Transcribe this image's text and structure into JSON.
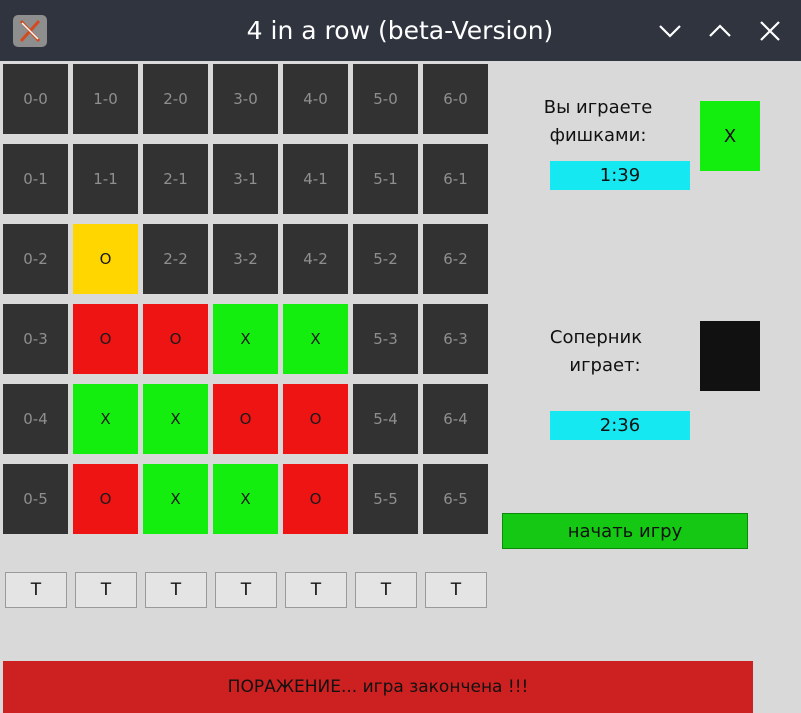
{
  "window": {
    "title": "4 in a row (beta-Version)",
    "app_icon": "x-logo-icon",
    "controls": [
      "minimize-icon",
      "maximize-icon",
      "close-icon"
    ]
  },
  "board": {
    "columns": 7,
    "rows": 6,
    "cells": [
      [
        "0-0",
        "1-0",
        "2-0",
        "3-0",
        "4-0",
        "5-0",
        "6-0"
      ],
      [
        "0-1",
        "1-1",
        "2-1",
        "3-1",
        "4-1",
        "5-1",
        "6-1"
      ],
      [
        "0-2",
        "O",
        "2-2",
        "3-2",
        "4-2",
        "5-2",
        "6-2"
      ],
      [
        "0-3",
        "O",
        "O",
        "X",
        "X",
        "5-3",
        "6-3"
      ],
      [
        "0-4",
        "X",
        "X",
        "O",
        "O",
        "5-4",
        "6-4"
      ],
      [
        "0-5",
        "O",
        "X",
        "X",
        "O",
        "5-5",
        "6-5"
      ]
    ],
    "cell_states": [
      [
        "empty",
        "empty",
        "empty",
        "empty",
        "empty",
        "empty",
        "empty"
      ],
      [
        "empty",
        "empty",
        "empty",
        "empty",
        "empty",
        "empty",
        "empty"
      ],
      [
        "empty",
        "yellow",
        "empty",
        "empty",
        "empty",
        "empty",
        "empty"
      ],
      [
        "empty",
        "red",
        "red",
        "green",
        "green",
        "empty",
        "empty"
      ],
      [
        "empty",
        "green",
        "green",
        "red",
        "red",
        "empty",
        "empty"
      ],
      [
        "empty",
        "red",
        "green",
        "green",
        "red",
        "empty",
        "empty"
      ]
    ],
    "colors": {
      "empty": "#323232",
      "yellow": "#ffd600",
      "red": "#ef1414",
      "green": "#13ee0f"
    },
    "drop_buttons": [
      "T",
      "T",
      "T",
      "T",
      "T",
      "T",
      "T"
    ]
  },
  "player": {
    "label_line1": "Вы играете",
    "label_line2": "фишками:",
    "piece": "X",
    "piece_color": "#13ee0f",
    "timer": "1:39"
  },
  "opponent": {
    "label_line1": "Соперник",
    "label_line2": "играет:",
    "piece": "",
    "piece_color": "#111111",
    "timer": "2:36"
  },
  "start_button": {
    "label": "начать игру",
    "color": "#14c814"
  },
  "status": {
    "message": "ПОРАЖЕНИЕ... игра закончена !!!",
    "color": "#cd2020"
  }
}
